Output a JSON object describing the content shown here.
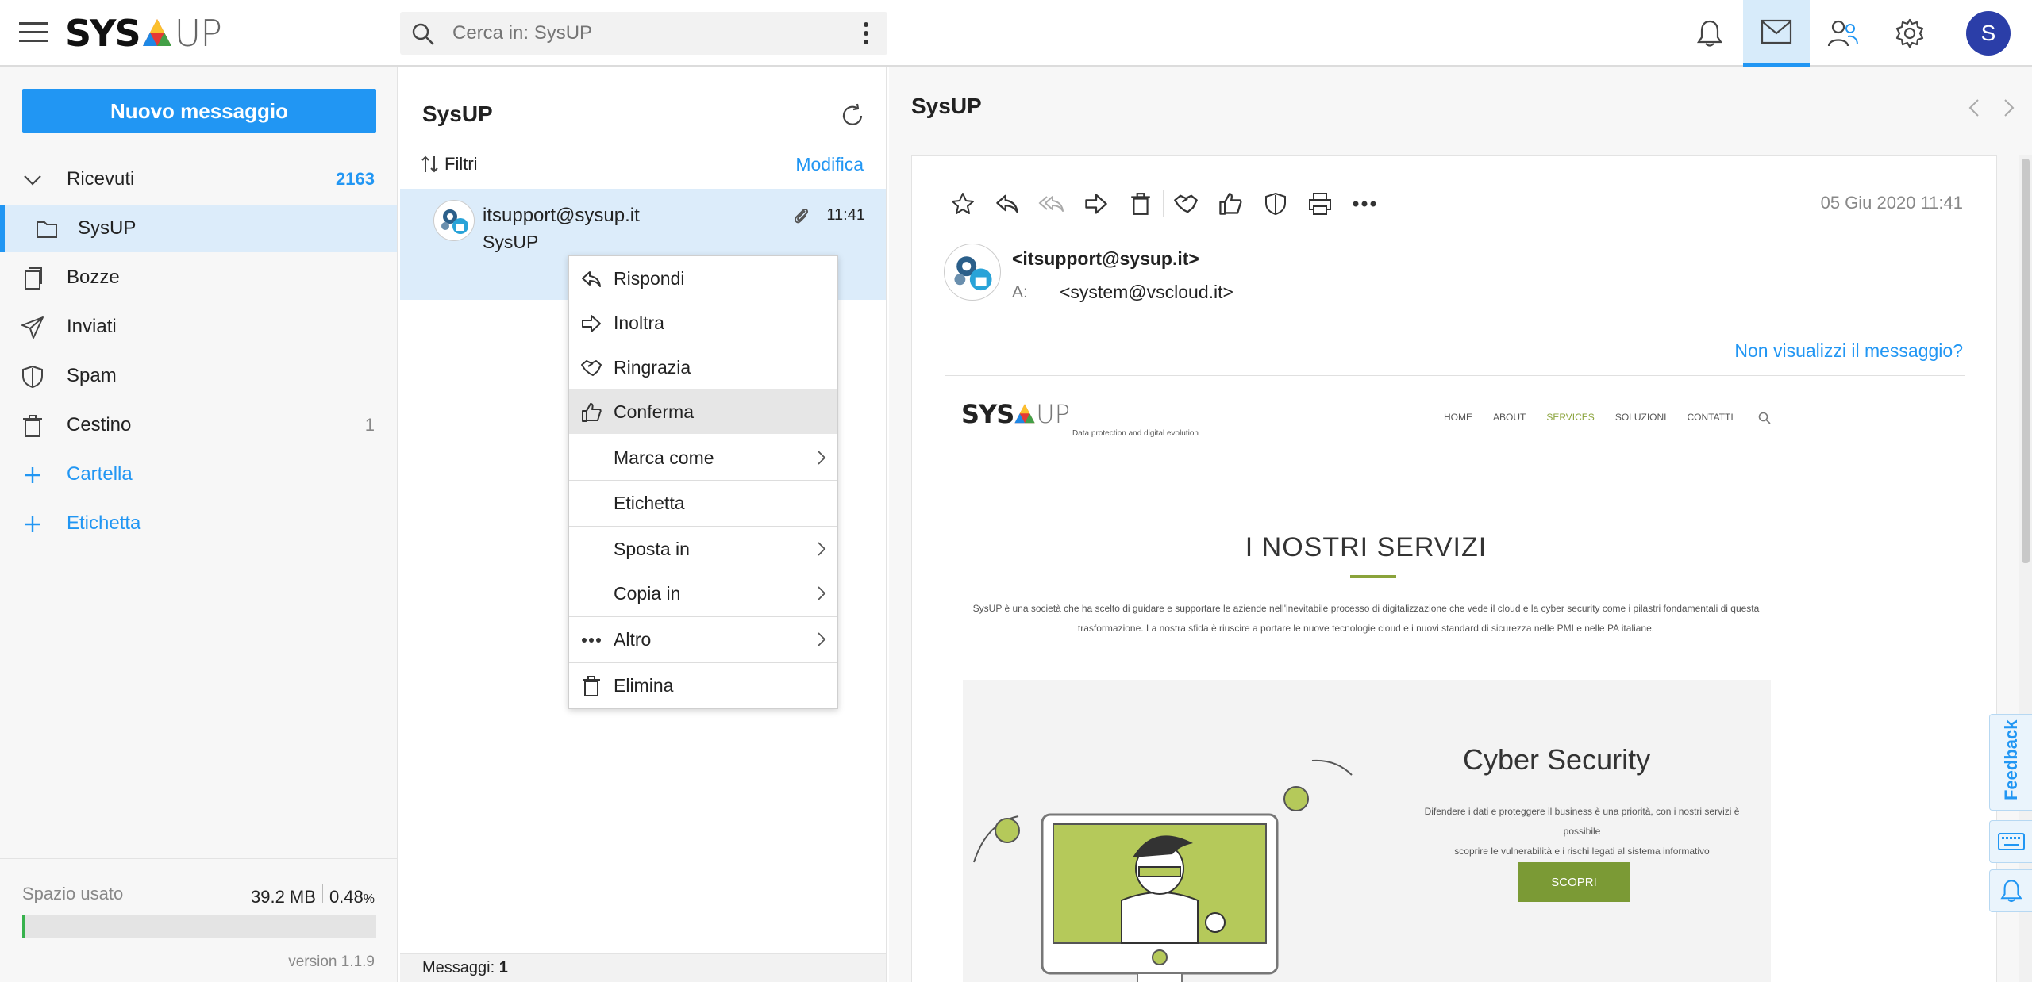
{
  "app": {
    "logo_left": "SYS",
    "logo_right": "UP"
  },
  "search": {
    "placeholder": "Cerca in: SysUP"
  },
  "header": {
    "icons": [
      "bell-icon",
      "mail-icon",
      "contacts-icon",
      "gear-icon"
    ],
    "avatar_letter": "S"
  },
  "sidebar": {
    "new_message_label": "Nuovo messaggio",
    "items": [
      {
        "label": "Ricevuti",
        "count": "2163",
        "icon": "chevron-down-icon"
      },
      {
        "label": "SysUP",
        "icon": "folder-icon"
      },
      {
        "label": "Bozze",
        "icon": "drafts-icon"
      },
      {
        "label": "Inviati",
        "icon": "send-icon"
      },
      {
        "label": "Spam",
        "icon": "shield-icon"
      },
      {
        "label": "Cestino",
        "count": "1",
        "icon": "trash-icon"
      },
      {
        "label": "Cartella",
        "icon": "plus-icon"
      },
      {
        "label": "Etichetta",
        "icon": "plus-icon"
      }
    ],
    "storage": {
      "label": "Spazio usato",
      "used": "39.2 MB",
      "percent": "0.48",
      "percent_symbol": "%",
      "fill_percent": 0.48
    },
    "version": "version 1.1.9"
  },
  "message_list": {
    "title": "SysUP",
    "filters_label": "Filtri",
    "edit_label": "Modifica",
    "messages": [
      {
        "from": "itsupport@sysup.it",
        "subject": "SysUP",
        "time": "11:41"
      }
    ],
    "footer_label": "Messaggi:",
    "footer_count": "1"
  },
  "context_menu": {
    "items": [
      {
        "label": "Rispondi",
        "icon": "reply-icon"
      },
      {
        "label": "Inoltra",
        "icon": "forward-icon"
      },
      {
        "label": "Ringrazia",
        "icon": "handshake-icon"
      },
      {
        "label": "Conferma",
        "icon": "thumbs-up-icon"
      },
      {
        "label": "Marca come",
        "submenu": true
      },
      {
        "label": "Etichetta"
      },
      {
        "label": "Sposta in",
        "submenu": true
      },
      {
        "label": "Copia in",
        "submenu": true
      },
      {
        "label": "Altro",
        "icon": "more-icon",
        "submenu": true
      },
      {
        "label": "Elimina",
        "icon": "trash-icon"
      }
    ]
  },
  "reader": {
    "title": "SysUP",
    "date": "05 Giu 2020 11:41",
    "sender": "<itsupport@sysup.it>",
    "to_label": "A:",
    "to_value": "<system@vscloud.it>",
    "not_shown_link": "Non visualizzi il messaggio?",
    "feedback_label": "Feedback"
  },
  "email_body": {
    "logo_left": "SYS",
    "logo_right": "UP",
    "tagline": "Data protection and digital evolution",
    "nav": [
      "HOME",
      "ABOUT",
      "SERVICES",
      "SOLUZIONI",
      "CONTATTI"
    ],
    "heading": "I NOSTRI SERVIZI",
    "paragraph_1": "SysUP è una società che ha scelto di guidare e supportare le aziende nell'inevitabile processo di digitalizzazione che vede il cloud e la cyber security come i pilastri fondamentali di questa",
    "paragraph_2": "trasformazione. La nostra sfida è riuscire a portare le nuove tecnologie cloud e i nuovi standard di sicurezza nelle PMI e nelle PA italiane.",
    "section_title": "Cyber Security",
    "section_text_1": "Difendere i dati e proteggere il business è una priorità, con i nostri servizi è possibile",
    "section_text_2": "scoprire le vulnerabilità e i rischi legati al sistema informativo",
    "cta": "SCOPRI"
  },
  "colors": {
    "accent": "#2196f3",
    "selected_bg": "#dcecfa",
    "brand_green": "#8aa33b",
    "avatar_bg": "#2b3ea8"
  }
}
